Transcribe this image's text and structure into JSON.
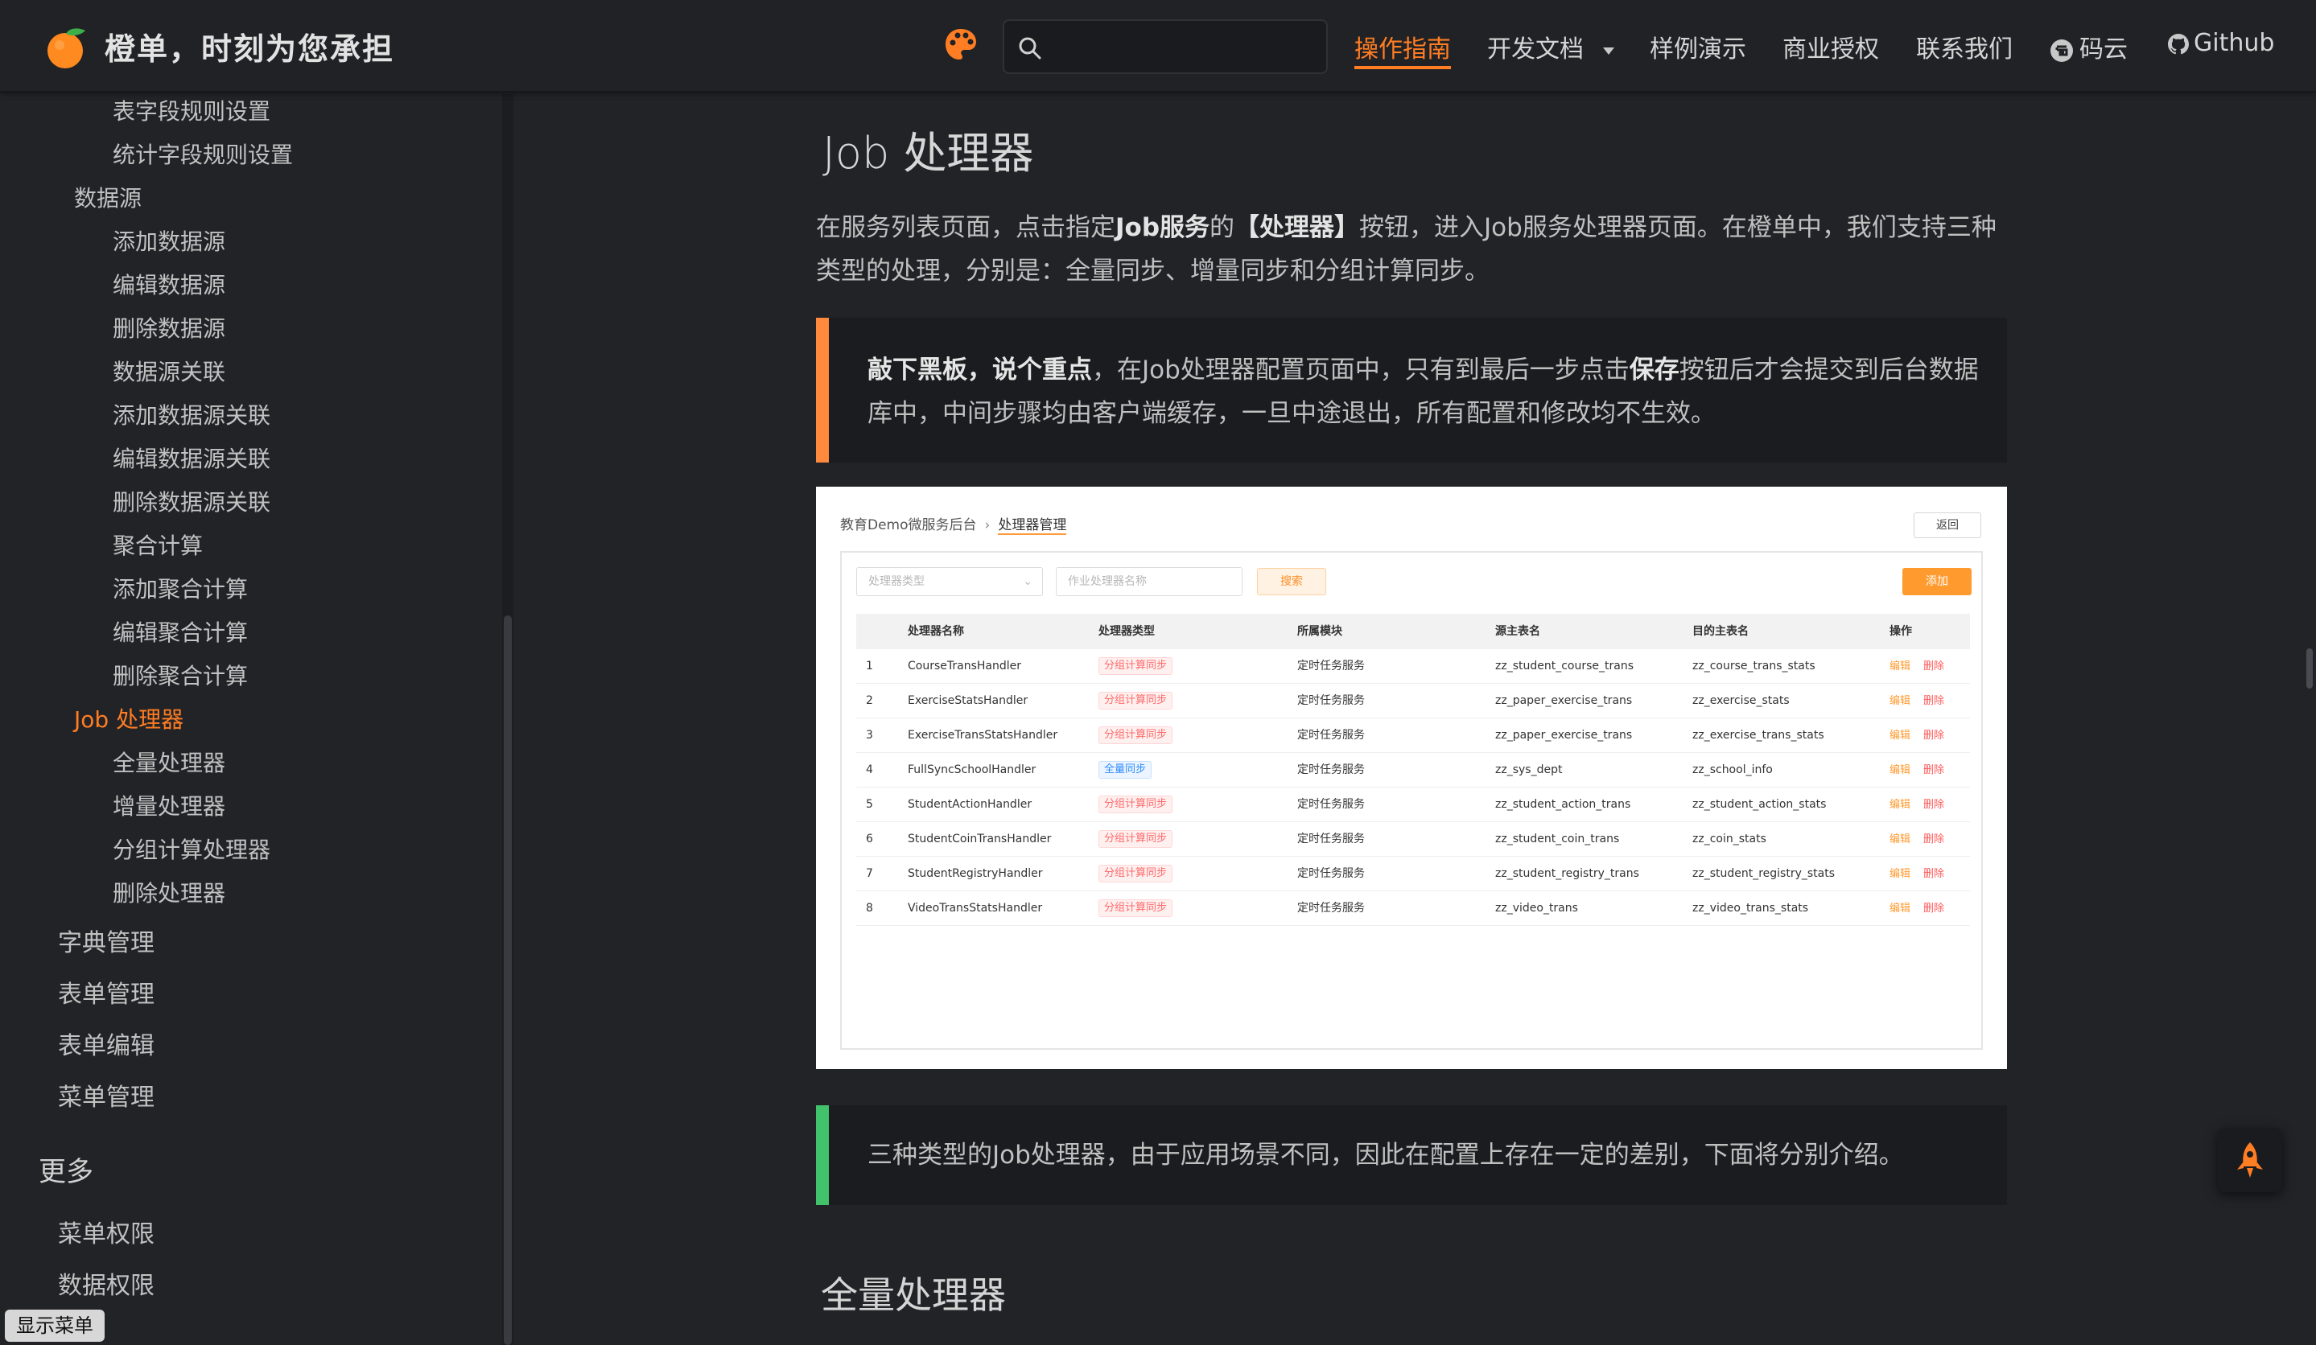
{
  "header": {
    "site_title": "橙单，时刻为您承担",
    "search_placeholder": "",
    "nav": [
      {
        "label": "操作指南",
        "active": true
      },
      {
        "label": "开发文档"
      },
      {
        "label": "样例演示"
      },
      {
        "label": "商业授权"
      },
      {
        "label": "联系我们"
      },
      {
        "label": "码云"
      },
      {
        "label": "Github"
      }
    ],
    "accent_color": "#ff7d23"
  },
  "sidebar": {
    "items": [
      "表字段规则设置",
      "统计字段规则设置",
      "数据源",
      "添加数据源",
      "编辑数据源",
      "删除数据源",
      "数据源关联",
      "添加数据源关联",
      "编辑数据源关联",
      "删除数据源关联",
      "聚合计算",
      "添加聚合计算",
      "编辑聚合计算",
      "删除聚合计算",
      "Job 处理器",
      "全量处理器",
      "增量处理器",
      "分组计算处理器",
      "删除处理器",
      "字典管理",
      "表单管理",
      "表单编辑",
      "菜单管理",
      "更多",
      "菜单权限",
      "数据权限"
    ],
    "show_menu": "显示菜单"
  },
  "content": {
    "title": "Job 处理器",
    "intro_parts": [
      "在服务列表页面，点击指定",
      "Job服务",
      "的",
      "【处理器】",
      "按钮，进入Job服务处理器页面。在橙单中，我们支持三种类型的处理，分别是：全量同步、增量同步和分组计算同步。"
    ],
    "tip1_parts": [
      "敲下黑板，说个重点",
      "，在Job处理器配置页面中，只有到最后一步点击",
      "保存",
      "按钮后才会提交到后台数据库中，中间步骤均由客户端缓存，一旦中途退出，所有配置和修改均不生效。"
    ],
    "tip1_color": "#ff8a3d",
    "tip2": "三种类型的Job处理器，由于应用场景不同，因此在配置上存在一定的差别，下面将分别介绍。",
    "tip2_color": "#42c26a",
    "h2": "全量处理器"
  },
  "screenshot": {
    "breadcrumb_root": "教育Demo微服务后台",
    "breadcrumb_current": "处理器管理",
    "back_label": "返回",
    "type_select_placeholder": "处理器类型",
    "name_input_placeholder": "作业处理器名称",
    "search_label": "搜索",
    "add_label": "添加",
    "columns": [
      "处理器名称",
      "处理器类型",
      "所属模块",
      "源主表名",
      "目的主表名",
      "操作"
    ],
    "rows": [
      {
        "idx": "1",
        "name": "CourseTransHandler",
        "type": "分组计算同步",
        "module": "定时任务服务",
        "src": "zz_student_course_trans",
        "dst": "zz_course_trans_stats"
      },
      {
        "idx": "2",
        "name": "ExerciseStatsHandler",
        "type": "分组计算同步",
        "module": "定时任务服务",
        "src": "zz_paper_exercise_trans",
        "dst": "zz_exercise_stats"
      },
      {
        "idx": "3",
        "name": "ExerciseTransStatsHandler",
        "type": "分组计算同步",
        "module": "定时任务服务",
        "src": "zz_paper_exercise_trans",
        "dst": "zz_exercise_trans_stats"
      },
      {
        "idx": "4",
        "name": "FullSyncSchoolHandler",
        "type": "全量同步",
        "module": "定时任务服务",
        "src": "zz_sys_dept",
        "dst": "zz_school_info"
      },
      {
        "idx": "5",
        "name": "StudentActionHandler",
        "type": "分组计算同步",
        "module": "定时任务服务",
        "src": "zz_student_action_trans",
        "dst": "zz_student_action_stats"
      },
      {
        "idx": "6",
        "name": "StudentCoinTransHandler",
        "type": "分组计算同步",
        "module": "定时任务服务",
        "src": "zz_student_coin_trans",
        "dst": "zz_coin_stats"
      },
      {
        "idx": "7",
        "name": "StudentRegistryHandler",
        "type": "分组计算同步",
        "module": "定时任务服务",
        "src": "zz_student_registry_trans",
        "dst": "zz_student_registry_stats"
      },
      {
        "idx": "8",
        "name": "VideoTransStatsHandler",
        "type": "分组计算同步",
        "module": "定时任务服务",
        "src": "zz_video_trans",
        "dst": "zz_video_trans_stats"
      }
    ],
    "edit_label": "编辑",
    "delete_label": "删除"
  }
}
